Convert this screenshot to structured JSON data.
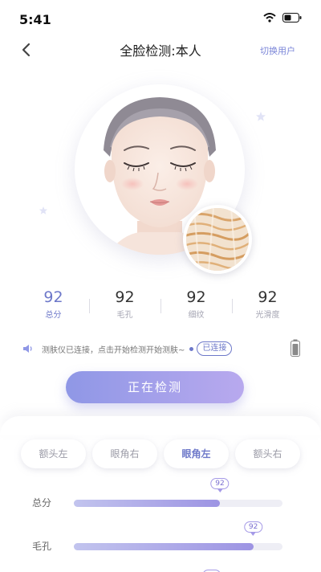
{
  "status_bar": {
    "time": "5:41"
  },
  "nav": {
    "title": "全脸检测:本人",
    "switch_user": "切换用户"
  },
  "scores": [
    {
      "value": "92",
      "label": "总分"
    },
    {
      "value": "92",
      "label": "毛孔"
    },
    {
      "value": "92",
      "label": "细纹"
    },
    {
      "value": "92",
      "label": "光滑度"
    }
  ],
  "connection": {
    "message": "测肤仪已连接，点击开始检测开始测肤~",
    "badge": "已连接"
  },
  "detect_button": "正在检测",
  "tabs": [
    "额头左",
    "眼角右",
    "眼角左",
    "额头右"
  ],
  "active_tab_index": 2,
  "metrics": [
    {
      "label": "总分",
      "value": "92",
      "level": 0.7
    },
    {
      "label": "毛孔",
      "value": "92",
      "level": 0.86
    }
  ],
  "colors": {
    "accent": "#6d78c9",
    "button_start": "#8f97e6",
    "button_end": "#b8a9ee"
  }
}
